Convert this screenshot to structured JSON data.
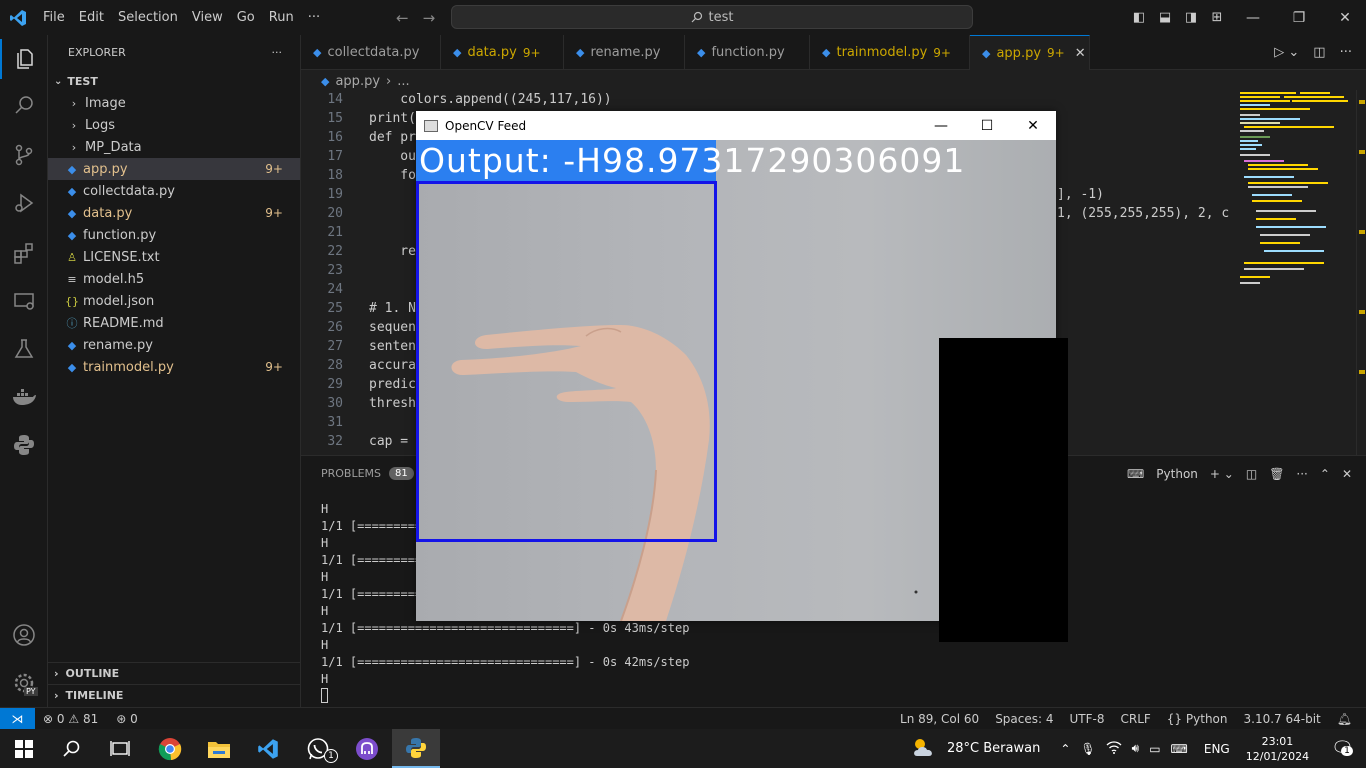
{
  "titlebar": {
    "menu": [
      "File",
      "Edit",
      "Selection",
      "View",
      "Go",
      "Run",
      "···"
    ],
    "search_text": "test"
  },
  "sidebar": {
    "header": "EXPLORER",
    "root": "TEST",
    "items": [
      {
        "label": "Image",
        "type": "folder"
      },
      {
        "label": "Logs",
        "type": "folder"
      },
      {
        "label": "MP_Data",
        "type": "folder"
      },
      {
        "label": "app.py",
        "type": "py",
        "badge": "9+"
      },
      {
        "label": "collectdata.py",
        "type": "py",
        "badge": ""
      },
      {
        "label": "data.py",
        "type": "py",
        "badge": "9+"
      },
      {
        "label": "function.py",
        "type": "py",
        "badge": ""
      },
      {
        "label": "LICENSE.txt",
        "type": "license",
        "badge": ""
      },
      {
        "label": "model.h5",
        "type": "h5",
        "badge": ""
      },
      {
        "label": "model.json",
        "type": "json",
        "badge": ""
      },
      {
        "label": "README.md",
        "type": "md",
        "badge": ""
      },
      {
        "label": "rename.py",
        "type": "py",
        "badge": ""
      },
      {
        "label": "trainmodel.py",
        "type": "py",
        "badge": "9+"
      }
    ],
    "outline": "OUTLINE",
    "timeline": "TIMELINE"
  },
  "tabs": [
    {
      "label": "collectdata.py",
      "count": ""
    },
    {
      "label": "data.py",
      "count": "9+"
    },
    {
      "label": "rename.py",
      "count": ""
    },
    {
      "label": "function.py",
      "count": ""
    },
    {
      "label": "trainmodel.py",
      "count": "9+"
    },
    {
      "label": "app.py",
      "count": "9+"
    }
  ],
  "breadcrumb": {
    "file": "app.py",
    "rest": "..."
  },
  "code": [
    {
      "ln": "14",
      "text": "    colors.append((245,117,16))"
    },
    {
      "ln": "15",
      "text": "print("
    },
    {
      "ln": "16",
      "text": "def pr"
    },
    {
      "ln": "17",
      "text": "    ou"
    },
    {
      "ln": "18",
      "text": "    fo"
    },
    {
      "ln": "19",
      "text": "        "
    },
    {
      "ln": "20",
      "text": "        "
    },
    {
      "ln": "21",
      "text": ""
    },
    {
      "ln": "22",
      "text": "    re"
    },
    {
      "ln": "23",
      "text": ""
    },
    {
      "ln": "24",
      "text": ""
    },
    {
      "ln": "25",
      "text": "# 1. N"
    },
    {
      "ln": "26",
      "text": "sequen"
    },
    {
      "ln": "27",
      "text": "senten"
    },
    {
      "ln": "28",
      "text": "accura"
    },
    {
      "ln": "29",
      "text": "predic"
    },
    {
      "ln": "30",
      "text": "thresh"
    },
    {
      "ln": "31",
      "text": ""
    },
    {
      "ln": "32",
      "text": "cap = "
    }
  ],
  "code_right": {
    "line19": "], -1)",
    "line20": "1, (255,255,255), 2, c"
  },
  "panel": {
    "tab": "PROBLEMS",
    "count": "81",
    "shell": "Python",
    "lines": [
      "H",
      "1/1 [=========",
      "H",
      "1/1 [=========",
      "H",
      "1/1 [=========",
      "H",
      "1/1 [==============================] - 0s 43ms/step",
      "H",
      "1/1 [==============================] - 0s 42ms/step",
      "H"
    ]
  },
  "statusbar": {
    "errors": "0",
    "warnings": "81",
    "ports": "0",
    "position": "Ln 89, Col 60",
    "spaces": "Spaces: 4",
    "encoding": "UTF-8",
    "eol": "CRLF",
    "language": "Python",
    "interpreter": "3.10.7 64-bit"
  },
  "cv_window": {
    "title": "OpenCV Feed",
    "output_text": "Output: -H98.97317290306091"
  },
  "taskbar": {
    "weather": "28°C  Berawan",
    "lang": "ENG",
    "time": "23:01",
    "date": "12/01/2024",
    "notif_count": "1",
    "whatsapp_badge": "1"
  },
  "colors": {
    "accent": "#0078d4",
    "modified": "#cca700",
    "output_bar": "#2b7ff0",
    "roi_box": "#1414e8"
  }
}
